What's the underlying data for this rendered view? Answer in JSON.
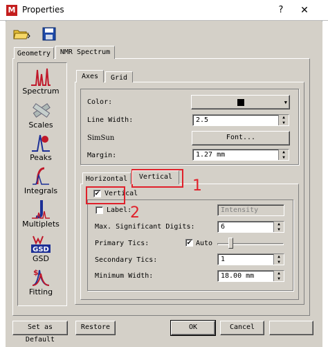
{
  "window": {
    "title": "Properties",
    "help_glyph": "?",
    "close_glyph": "✕",
    "app_icon_glyph": "M"
  },
  "top_tabs": [
    {
      "label": "Geometry"
    },
    {
      "label": "NMR Spectrum"
    }
  ],
  "sidebar": {
    "items": [
      {
        "label": "Spectrum"
      },
      {
        "label": "Scales"
      },
      {
        "label": "Peaks"
      },
      {
        "label": "Integrals"
      },
      {
        "label": "Multiplets"
      },
      {
        "label": "GSD"
      },
      {
        "label": "Fitting"
      }
    ]
  },
  "axes_tabs": [
    {
      "label": "Axes"
    },
    {
      "label": "Grid"
    }
  ],
  "axes": {
    "color_label": "Color:",
    "line_width_label": "Line Width:",
    "line_width_value": "2.5",
    "font_name": "SimSun",
    "font_button": "Font...",
    "margin_label": "Margin:",
    "margin_value": "1.27 mm"
  },
  "orientation_tabs": [
    {
      "label": "Horizontal"
    },
    {
      "label": "Vertical"
    }
  ],
  "vertical": {
    "vertical_check_label": "Vertical",
    "label_check_label": "Label:",
    "label_placeholder": "Intensity",
    "max_digits_label": "Max. Significant Digits:",
    "max_digits_value": "6",
    "primary_tics_label": "Primary Tics:",
    "auto_label": "Auto",
    "secondary_tics_label": "Secondary Tics:",
    "secondary_tics_value": "1",
    "min_width_label": "Minimum Width:",
    "min_width_value": "18.00 mm"
  },
  "annotations": {
    "one": "1",
    "two": "2"
  },
  "footer": {
    "set_default": "Set as Default",
    "restore": "Restore",
    "ok": "OK",
    "cancel": "Cancel"
  },
  "colors": {
    "accent_red": "#e0202a",
    "dialog_bg": "#d4d0c8",
    "swatch": "#000000"
  }
}
